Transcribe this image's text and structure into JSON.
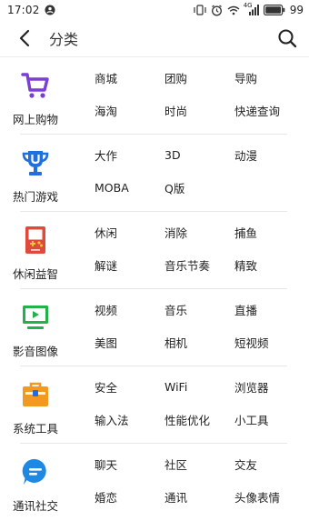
{
  "status_bar": {
    "time": "17:02",
    "network_label": "4G",
    "battery": "99"
  },
  "header": {
    "title": "分类"
  },
  "categories": [
    {
      "name": "网上购物",
      "icon": "shopping-cart-icon",
      "color": "#7b3fd6",
      "items": [
        "商城",
        "团购",
        "导购",
        "海淘",
        "时尚",
        "快递查询"
      ]
    },
    {
      "name": "热门游戏",
      "icon": "trophy-icon",
      "color": "#1f6fe0",
      "items": [
        "大作",
        "3D",
        "动漫",
        "MOBA",
        "Q版"
      ]
    },
    {
      "name": "休闲益智",
      "icon": "game-console-icon",
      "color": "#e04a3a",
      "items": [
        "休闲",
        "消除",
        "捕鱼",
        "解谜",
        "音乐节奏",
        "精致"
      ]
    },
    {
      "name": "影音图像",
      "icon": "monitor-play-icon",
      "color": "#22b24c",
      "items": [
        "视频",
        "音乐",
        "直播",
        "美图",
        "相机",
        "短视频"
      ]
    },
    {
      "name": "系统工具",
      "icon": "toolbox-icon",
      "color": "#f29a1f",
      "items": [
        "安全",
        "WiFi",
        "浏览器",
        "输入法",
        "性能优化",
        "小工具"
      ]
    },
    {
      "name": "通讯社交",
      "icon": "chat-bubble-icon",
      "color": "#1e88e5",
      "items": [
        "聊天",
        "社区",
        "交友",
        "婚恋",
        "通讯",
        "头像表情"
      ]
    }
  ]
}
